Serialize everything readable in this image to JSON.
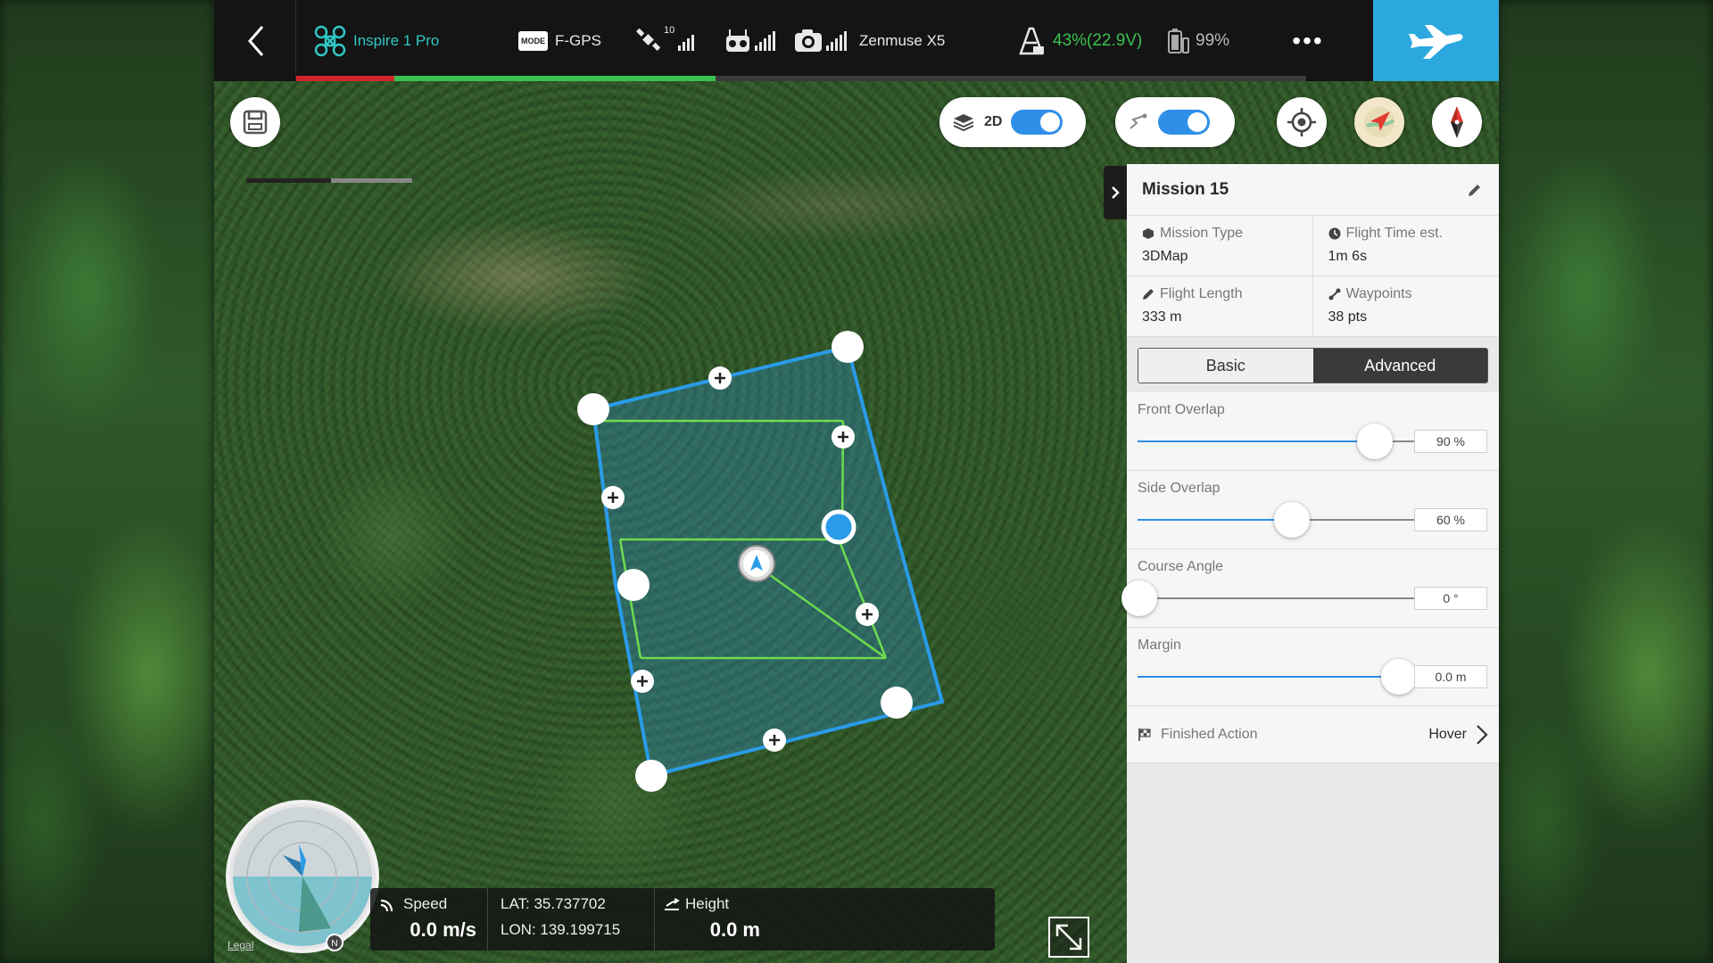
{
  "topbar": {
    "aircraft": "Inspire 1 Pro",
    "mode_badge": "MODE",
    "gps_mode": "F-GPS",
    "satellite_count": "10",
    "camera_name": "Zenmuse X5",
    "aircraft_battery": "43%(22.9V)",
    "remote_battery": "99%",
    "more": "•••",
    "colors": {
      "accent": "#2ba8de",
      "battery_ok": "#39c24f",
      "warning": "#d1262a"
    }
  },
  "map_controls": {
    "view_label": "2D",
    "view_toggle_on": true,
    "path_toggle_on": true
  },
  "panel": {
    "title": "Mission 15",
    "info": [
      {
        "label": "Mission Type",
        "value": "3DMap",
        "icon": "mission-type-icon"
      },
      {
        "label": "Flight Time est.",
        "value": "1m 6s",
        "icon": "clock-icon"
      },
      {
        "label": "Flight Length",
        "value": "333 m",
        "icon": "ruler-icon"
      },
      {
        "label": "Waypoints",
        "value": "38 pts",
        "icon": "waypoints-icon"
      }
    ],
    "tabs": [
      "Basic",
      "Advanced"
    ],
    "active_tab": "Advanced",
    "sliders": [
      {
        "label": "Front Overlap",
        "value": "90 %",
        "level": 0.85
      },
      {
        "label": "Side Overlap",
        "value": "60 %",
        "level": 0.55
      },
      {
        "label": "Course Angle",
        "value": "0 °",
        "level": 0.0
      },
      {
        "label": "Margin",
        "value": "0.0 m",
        "level": 0.94
      }
    ],
    "finished_action_label": "Finished Action",
    "finished_action_value": "Hover"
  },
  "telemetry": {
    "speed_label": "Speed",
    "speed_value": "0.0 m/s",
    "lat": "LAT: 35.737702",
    "lon": "LON: 139.199715",
    "height_label": "Height",
    "height_value": "0.0 m"
  },
  "legal": "Legal",
  "compass_north": "N"
}
